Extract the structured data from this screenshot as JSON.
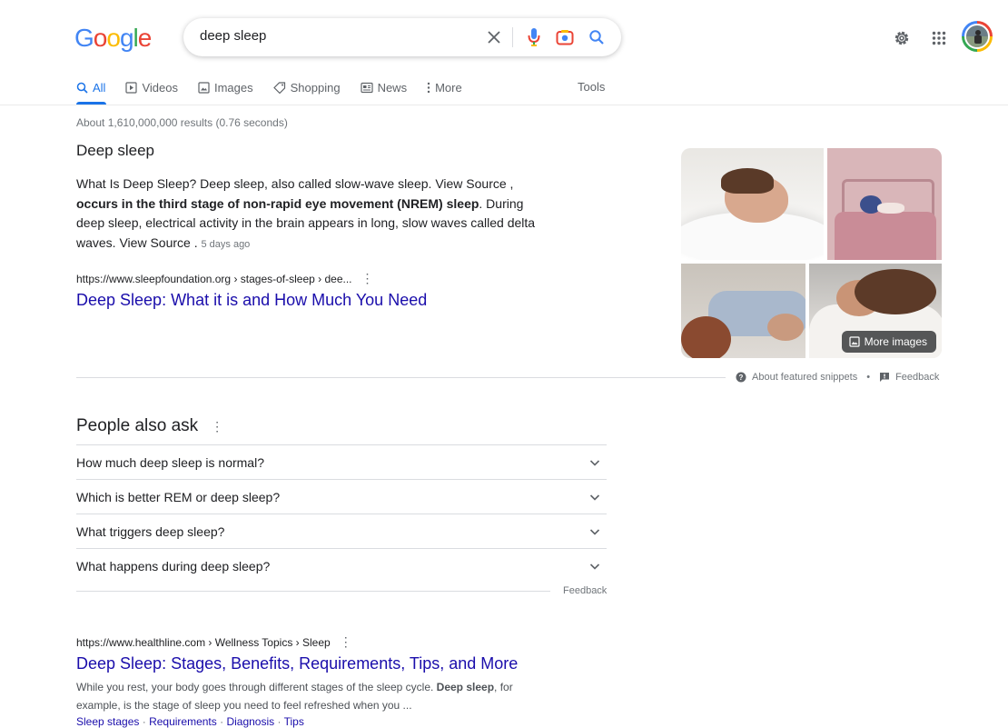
{
  "logo": {
    "text": "Google"
  },
  "search": {
    "query": "deep sleep"
  },
  "tabs": [
    {
      "label": "All",
      "icon": "search-icon"
    },
    {
      "label": "Videos",
      "icon": "video-icon"
    },
    {
      "label": "Images",
      "icon": "image-icon"
    },
    {
      "label": "Shopping",
      "icon": "tag-icon"
    },
    {
      "label": "News",
      "icon": "news-icon"
    },
    {
      "label": "More",
      "icon": "vertical-dots-icon"
    }
  ],
  "tools_label": "Tools",
  "stats": "About 1,610,000,000 results (0.76 seconds)",
  "featured_snippet": {
    "title": "Deep sleep",
    "text_1": "What Is Deep Sleep? Deep sleep, also called slow-wave sleep. View Source ,",
    "text_bold": "occurs in the third stage of non-rapid eye movement (NREM) sleep",
    "text_2": ". During deep sleep, electrical activity in the brain appears in long, slow waves called delta waves. View Source .",
    "date": "5 days ago",
    "cite": "https://www.sleepfoundation.org › stages-of-sleep › dee...",
    "link_title": "Deep Sleep: What it is and How Much You Need",
    "more_images": "More images",
    "about_label": "About featured snippets",
    "feedback_label": "Feedback"
  },
  "people_also_ask": {
    "title": "People also ask",
    "questions": [
      "How much deep sleep is normal?",
      "Which is better REM or deep sleep?",
      "What triggers deep sleep?",
      "What happens during deep sleep?"
    ],
    "feedback_label": "Feedback"
  },
  "result_2": {
    "cite": "https://www.healthline.com › Wellness Topics › Sleep",
    "title": "Deep Sleep: Stages, Benefits, Requirements, Tips, and More",
    "body_1": "While you rest, your body goes through different stages of the sleep cycle. ",
    "body_bold": "Deep sleep",
    "body_2": ", for example, is the stage of sleep you need to feel refreshed when you ...",
    "sitelinks": [
      "Sleep stages",
      "Requirements",
      "Diagnosis",
      "Tips"
    ]
  },
  "colors": {
    "link": "#1a0dab",
    "accent": "#1a73e8"
  }
}
